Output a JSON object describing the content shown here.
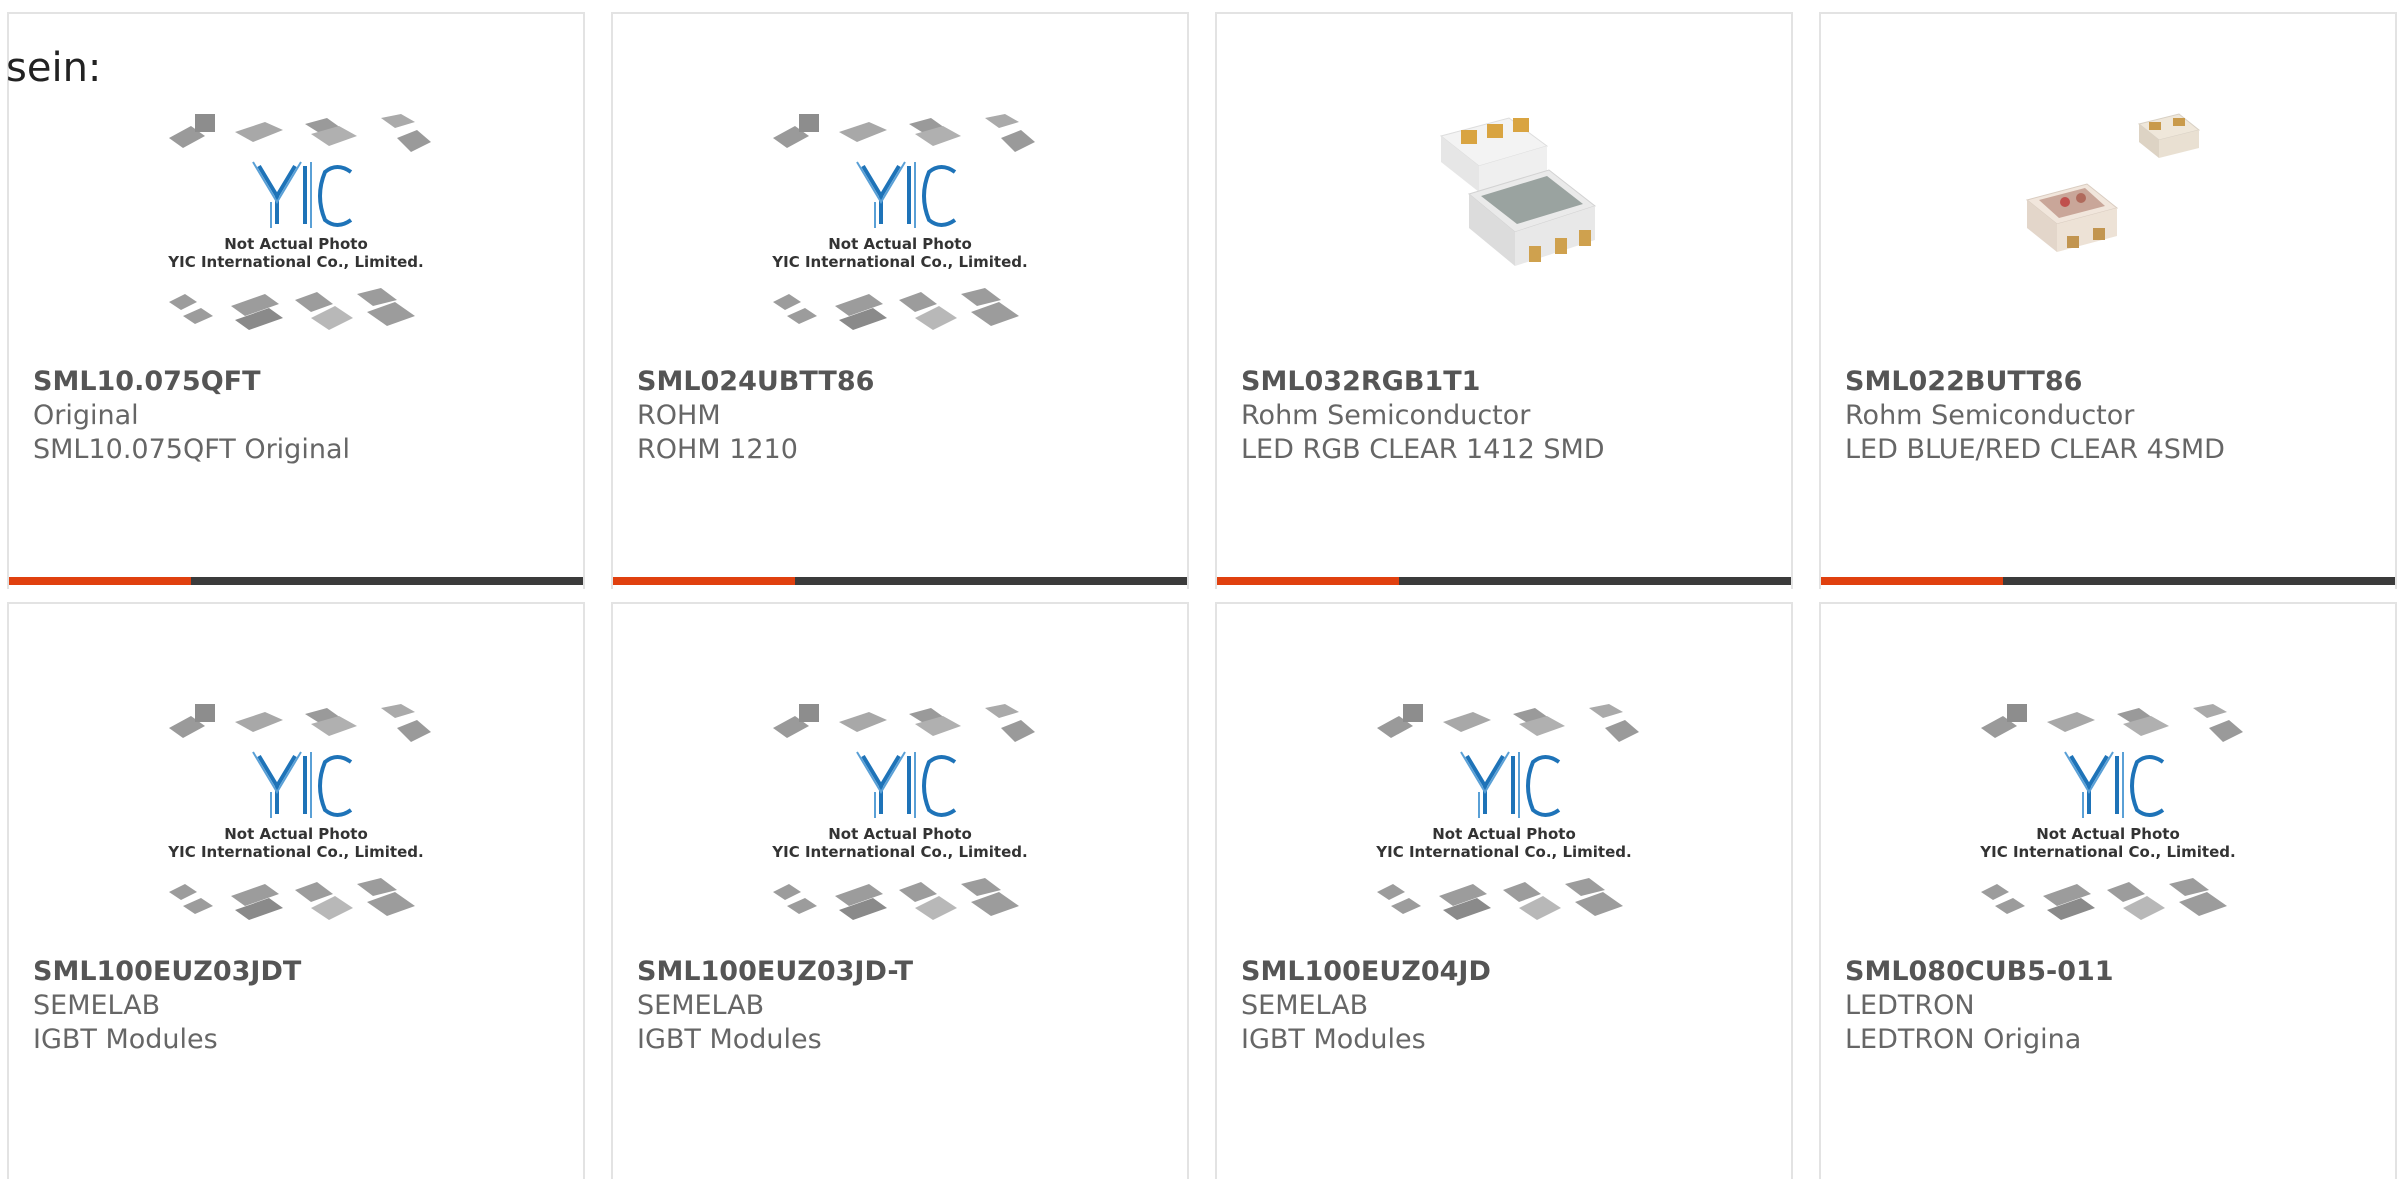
{
  "intro_text": "sein:",
  "placeholder": {
    "brand": "YIC",
    "line1": "Not Actual Photo",
    "line2": "YIC International Co., Limited."
  },
  "products": [
    {
      "part": "SML10.075QFT",
      "maker": "Original",
      "desc": "SML10.075QFT Original",
      "image": "placeholder-image"
    },
    {
      "part": "SML024UBTT86",
      "maker": "ROHM",
      "desc": "ROHM 1210",
      "image": "placeholder-image"
    },
    {
      "part": "SML032RGB1T1",
      "maker": "Rohm Semiconductor",
      "desc": "LED RGB CLEAR 1412 SMD",
      "image": "smd-led-photo"
    },
    {
      "part": "SML022BUTT86",
      "maker": "Rohm Semiconductor",
      "desc": "LED BLUE/RED CLEAR 4SMD",
      "image": "smd-led-photo"
    },
    {
      "part": "SML100EUZ03JDT",
      "maker": "SEMELAB",
      "desc": "IGBT Modules",
      "image": "placeholder-image"
    },
    {
      "part": "SML100EUZ03JD-T",
      "maker": "SEMELAB",
      "desc": "IGBT Modules",
      "image": "placeholder-image"
    },
    {
      "part": "SML100EUZ04JD",
      "maker": "SEMELAB",
      "desc": "IGBT Modules",
      "image": "placeholder-image"
    },
    {
      "part": "SML080CUB5-011",
      "maker": "LEDTRON",
      "desc": "LEDTRON Origina",
      "image": "placeholder-image"
    }
  ],
  "colors": {
    "accent": "#e0400f",
    "bar": "#3b3b3b",
    "border": "#e3e3e3",
    "brand_blue": "#1e73b8"
  }
}
